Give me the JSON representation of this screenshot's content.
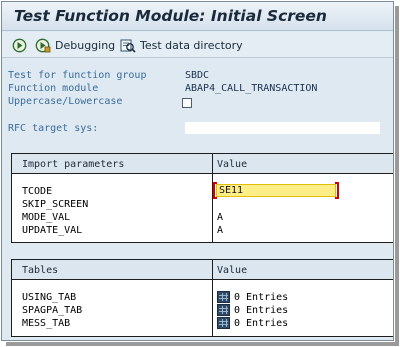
{
  "window": {
    "title": "Test Function Module: Initial Screen"
  },
  "toolbar": {
    "debugging_label": "Debugging",
    "test_data_directory_label": "Test data directory",
    "execute_icon": "execute-icon",
    "debug_icon": "debugging-icon",
    "tdd_icon": "test-data-directory-icon"
  },
  "form": {
    "function_group_label": "Test for function group",
    "function_group_value": "SBDC",
    "function_module_label": "Function module",
    "function_module_value": "ABAP4_CALL_TRANSACTION",
    "case_label": "Uppercase/Lowercase",
    "case_checked": false,
    "rfc_label": "RFC target sys:",
    "rfc_value": ""
  },
  "import_table": {
    "headers": [
      "Import parameters",
      "Value"
    ],
    "rows": [
      {
        "name": "TCODE",
        "value": "SE11"
      },
      {
        "name": "SKIP_SCREEN",
        "value": ""
      },
      {
        "name": "MODE_VAL",
        "value": "A"
      },
      {
        "name": "UPDATE_VAL",
        "value": "A"
      }
    ]
  },
  "tables_table": {
    "headers": [
      "Tables",
      "Value"
    ],
    "rows": [
      {
        "name": "USING_TAB",
        "value": "0 Entries"
      },
      {
        "name": "SPAGPA_TAB",
        "value": "0 Entries"
      },
      {
        "name": "MESS_TAB",
        "value": "0 Entries"
      }
    ]
  },
  "colors": {
    "label_blue": "#3a6c9a",
    "screen_bg": "#dfe9f1",
    "input_highlight": "#ffee88",
    "focus_bracket": "#d40000"
  }
}
